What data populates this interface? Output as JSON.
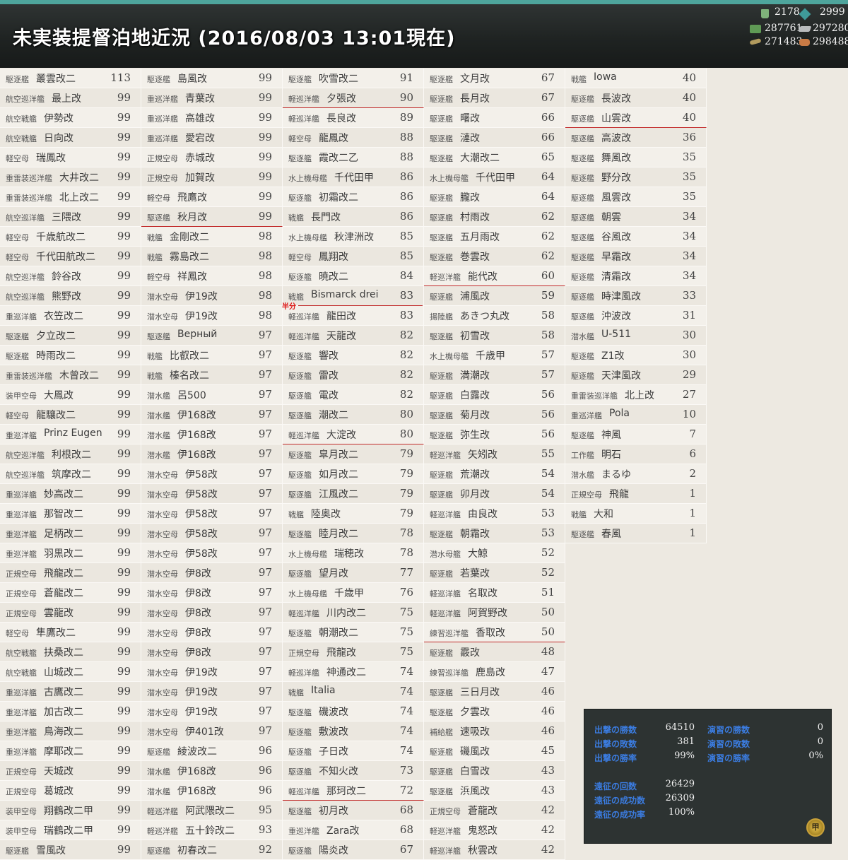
{
  "header": {
    "title": "未実装提督泊地近況 (2016/08/03 13:01現在)",
    "bucket": "2178",
    "devmat": "2999",
    "fuel": "287761",
    "steel": "297280",
    "ammo": "271483",
    "bauxite": "298488"
  },
  "hanbun_label": "半分",
  "ships": [
    {
      "type": "駆逐艦",
      "name": "叢雲改二",
      "lv": "113"
    },
    {
      "type": "航空巡洋艦",
      "name": "最上改",
      "lv": "99"
    },
    {
      "type": "航空戦艦",
      "name": "伊勢改",
      "lv": "99"
    },
    {
      "type": "航空戦艦",
      "name": "日向改",
      "lv": "99"
    },
    {
      "type": "軽空母",
      "name": "瑞鳳改",
      "lv": "99"
    },
    {
      "type": "重雷装巡洋艦",
      "name": "大井改二",
      "lv": "99"
    },
    {
      "type": "重雷装巡洋艦",
      "name": "北上改二",
      "lv": "99"
    },
    {
      "type": "航空巡洋艦",
      "name": "三隈改",
      "lv": "99"
    },
    {
      "type": "軽空母",
      "name": "千歳航改二",
      "lv": "99"
    },
    {
      "type": "軽空母",
      "name": "千代田航改二",
      "lv": "99"
    },
    {
      "type": "航空巡洋艦",
      "name": "鈴谷改",
      "lv": "99"
    },
    {
      "type": "航空巡洋艦",
      "name": "熊野改",
      "lv": "99"
    },
    {
      "type": "重巡洋艦",
      "name": "衣笠改二",
      "lv": "99"
    },
    {
      "type": "駆逐艦",
      "name": "夕立改二",
      "lv": "99"
    },
    {
      "type": "駆逐艦",
      "name": "時雨改二",
      "lv": "99"
    },
    {
      "type": "重雷装巡洋艦",
      "name": "木曾改二",
      "lv": "99"
    },
    {
      "type": "装甲空母",
      "name": "大鳳改",
      "lv": "99"
    },
    {
      "type": "軽空母",
      "name": "龍驤改二",
      "lv": "99"
    },
    {
      "type": "重巡洋艦",
      "name": "Prinz Eugen",
      "lv": "99"
    },
    {
      "type": "航空巡洋艦",
      "name": "利根改二",
      "lv": "99"
    },
    {
      "type": "航空巡洋艦",
      "name": "筑摩改二",
      "lv": "99"
    },
    {
      "type": "重巡洋艦",
      "name": "妙高改二",
      "lv": "99"
    },
    {
      "type": "重巡洋艦",
      "name": "那智改二",
      "lv": "99"
    },
    {
      "type": "重巡洋艦",
      "name": "足柄改二",
      "lv": "99"
    },
    {
      "type": "重巡洋艦",
      "name": "羽黒改二",
      "lv": "99"
    },
    {
      "type": "正規空母",
      "name": "飛龍改二",
      "lv": "99"
    },
    {
      "type": "正規空母",
      "name": "蒼龍改二",
      "lv": "99"
    },
    {
      "type": "正規空母",
      "name": "雲龍改",
      "lv": "99"
    },
    {
      "type": "軽空母",
      "name": "隼鷹改二",
      "lv": "99"
    },
    {
      "type": "航空戦艦",
      "name": "扶桑改二",
      "lv": "99"
    },
    {
      "type": "航空戦艦",
      "name": "山城改二",
      "lv": "99"
    },
    {
      "type": "重巡洋艦",
      "name": "古鷹改二",
      "lv": "99"
    },
    {
      "type": "重巡洋艦",
      "name": "加古改二",
      "lv": "99"
    },
    {
      "type": "重巡洋艦",
      "name": "鳥海改二",
      "lv": "99"
    },
    {
      "type": "重巡洋艦",
      "name": "摩耶改二",
      "lv": "99"
    },
    {
      "type": "正規空母",
      "name": "天城改",
      "lv": "99"
    },
    {
      "type": "正規空母",
      "name": "葛城改",
      "lv": "99"
    },
    {
      "type": "装甲空母",
      "name": "翔鶴改二甲",
      "lv": "99"
    },
    {
      "type": "装甲空母",
      "name": "瑞鶴改二甲",
      "lv": "99"
    },
    {
      "type": "駆逐艦",
      "name": "雪風改",
      "lv": "99"
    },
    {
      "type": "駆逐艦",
      "name": "島風改",
      "lv": "99"
    },
    {
      "type": "重巡洋艦",
      "name": "青葉改",
      "lv": "99"
    },
    {
      "type": "重巡洋艦",
      "name": "高雄改",
      "lv": "99"
    },
    {
      "type": "重巡洋艦",
      "name": "愛宕改",
      "lv": "99"
    },
    {
      "type": "正規空母",
      "name": "赤城改",
      "lv": "99"
    },
    {
      "type": "正規空母",
      "name": "加賀改",
      "lv": "99"
    },
    {
      "type": "軽空母",
      "name": "飛鷹改",
      "lv": "99"
    },
    {
      "type": "駆逐艦",
      "name": "秋月改",
      "lv": "99"
    },
    {
      "type": "戦艦",
      "name": "金剛改二",
      "lv": "98"
    },
    {
      "type": "戦艦",
      "name": "霧島改二",
      "lv": "98"
    },
    {
      "type": "軽空母",
      "name": "祥鳳改",
      "lv": "98"
    },
    {
      "type": "潜水空母",
      "name": "伊19改",
      "lv": "98"
    },
    {
      "type": "潜水空母",
      "name": "伊19改",
      "lv": "98"
    },
    {
      "type": "駆逐艦",
      "name": "Верный",
      "lv": "97"
    },
    {
      "type": "戦艦",
      "name": "比叡改二",
      "lv": "97"
    },
    {
      "type": "戦艦",
      "name": "榛名改二",
      "lv": "97"
    },
    {
      "type": "潜水艦",
      "name": "呂500",
      "lv": "97"
    },
    {
      "type": "潜水艦",
      "name": "伊168改",
      "lv": "97"
    },
    {
      "type": "潜水艦",
      "name": "伊168改",
      "lv": "97"
    },
    {
      "type": "潜水艦",
      "name": "伊168改",
      "lv": "97"
    },
    {
      "type": "潜水空母",
      "name": "伊58改",
      "lv": "97"
    },
    {
      "type": "潜水空母",
      "name": "伊58改",
      "lv": "97"
    },
    {
      "type": "潜水空母",
      "name": "伊58改",
      "lv": "97"
    },
    {
      "type": "潜水空母",
      "name": "伊58改",
      "lv": "97"
    },
    {
      "type": "潜水空母",
      "name": "伊58改",
      "lv": "97"
    },
    {
      "type": "潜水空母",
      "name": "伊8改",
      "lv": "97"
    },
    {
      "type": "潜水空母",
      "name": "伊8改",
      "lv": "97"
    },
    {
      "type": "潜水空母",
      "name": "伊8改",
      "lv": "97"
    },
    {
      "type": "潜水空母",
      "name": "伊8改",
      "lv": "97"
    },
    {
      "type": "潜水空母",
      "name": "伊8改",
      "lv": "97"
    },
    {
      "type": "潜水空母",
      "name": "伊19改",
      "lv": "97"
    },
    {
      "type": "潜水空母",
      "name": "伊19改",
      "lv": "97"
    },
    {
      "type": "潜水空母",
      "name": "伊19改",
      "lv": "97"
    },
    {
      "type": "潜水空母",
      "name": "伊401改",
      "lv": "97"
    },
    {
      "type": "駆逐艦",
      "name": "綾波改二",
      "lv": "96"
    },
    {
      "type": "潜水艦",
      "name": "伊168改",
      "lv": "96"
    },
    {
      "type": "潜水艦",
      "name": "伊168改",
      "lv": "96"
    },
    {
      "type": "軽巡洋艦",
      "name": "阿武隈改二",
      "lv": "95"
    },
    {
      "type": "軽巡洋艦",
      "name": "五十鈴改二",
      "lv": "93"
    },
    {
      "type": "駆逐艦",
      "name": "初春改二",
      "lv": "92"
    },
    {
      "type": "駆逐艦",
      "name": "吹雪改二",
      "lv": "91"
    },
    {
      "type": "軽巡洋艦",
      "name": "夕張改",
      "lv": "90"
    },
    {
      "type": "軽巡洋艦",
      "name": "長良改",
      "lv": "89"
    },
    {
      "type": "軽空母",
      "name": "龍鳳改",
      "lv": "88"
    },
    {
      "type": "駆逐艦",
      "name": "霞改二乙",
      "lv": "88"
    },
    {
      "type": "水上機母艦",
      "name": "千代田甲",
      "lv": "86"
    },
    {
      "type": "駆逐艦",
      "name": "初霜改二",
      "lv": "86"
    },
    {
      "type": "戦艦",
      "name": "長門改",
      "lv": "86"
    },
    {
      "type": "水上機母艦",
      "name": "秋津洲改",
      "lv": "85"
    },
    {
      "type": "軽空母",
      "name": "鳳翔改",
      "lv": "85"
    },
    {
      "type": "駆逐艦",
      "name": "暁改二",
      "lv": "84"
    },
    {
      "type": "戦艦",
      "name": "Bismarck drei",
      "lv": "83"
    },
    {
      "type": "軽巡洋艦",
      "name": "龍田改",
      "lv": "83"
    },
    {
      "type": "軽巡洋艦",
      "name": "天龍改",
      "lv": "82"
    },
    {
      "type": "駆逐艦",
      "name": "響改",
      "lv": "82"
    },
    {
      "type": "駆逐艦",
      "name": "雷改",
      "lv": "82"
    },
    {
      "type": "駆逐艦",
      "name": "電改",
      "lv": "82"
    },
    {
      "type": "駆逐艦",
      "name": "潮改二",
      "lv": "80"
    },
    {
      "type": "軽巡洋艦",
      "name": "大淀改",
      "lv": "80"
    },
    {
      "type": "駆逐艦",
      "name": "皐月改二",
      "lv": "79"
    },
    {
      "type": "駆逐艦",
      "name": "如月改二",
      "lv": "79"
    },
    {
      "type": "駆逐艦",
      "name": "江風改二",
      "lv": "79"
    },
    {
      "type": "戦艦",
      "name": "陸奥改",
      "lv": "79"
    },
    {
      "type": "駆逐艦",
      "name": "睦月改二",
      "lv": "78"
    },
    {
      "type": "水上機母艦",
      "name": "瑞穂改",
      "lv": "78"
    },
    {
      "type": "駆逐艦",
      "name": "望月改",
      "lv": "77"
    },
    {
      "type": "水上機母艦",
      "name": "千歳甲",
      "lv": "76"
    },
    {
      "type": "軽巡洋艦",
      "name": "川内改二",
      "lv": "75"
    },
    {
      "type": "駆逐艦",
      "name": "朝潮改二",
      "lv": "75"
    },
    {
      "type": "正規空母",
      "name": "飛龍改",
      "lv": "75"
    },
    {
      "type": "軽巡洋艦",
      "name": "神通改二",
      "lv": "74"
    },
    {
      "type": "戦艦",
      "name": "Italia",
      "lv": "74"
    },
    {
      "type": "駆逐艦",
      "name": "磯波改",
      "lv": "74"
    },
    {
      "type": "駆逐艦",
      "name": "敷波改",
      "lv": "74"
    },
    {
      "type": "駆逐艦",
      "name": "子日改",
      "lv": "74"
    },
    {
      "type": "駆逐艦",
      "name": "不知火改",
      "lv": "73"
    },
    {
      "type": "軽巡洋艦",
      "name": "那珂改二",
      "lv": "72"
    },
    {
      "type": "駆逐艦",
      "name": "初月改",
      "lv": "68"
    },
    {
      "type": "重巡洋艦",
      "name": "Zara改",
      "lv": "68"
    },
    {
      "type": "駆逐艦",
      "name": "陽炎改",
      "lv": "67"
    },
    {
      "type": "駆逐艦",
      "name": "文月改",
      "lv": "67"
    },
    {
      "type": "駆逐艦",
      "name": "長月改",
      "lv": "67"
    },
    {
      "type": "駆逐艦",
      "name": "曙改",
      "lv": "66"
    },
    {
      "type": "駆逐艦",
      "name": "漣改",
      "lv": "66"
    },
    {
      "type": "駆逐艦",
      "name": "大潮改二",
      "lv": "65"
    },
    {
      "type": "水上機母艦",
      "name": "千代田甲",
      "lv": "64"
    },
    {
      "type": "駆逐艦",
      "name": "朧改",
      "lv": "64"
    },
    {
      "type": "駆逐艦",
      "name": "村雨改",
      "lv": "62"
    },
    {
      "type": "駆逐艦",
      "name": "五月雨改",
      "lv": "62"
    },
    {
      "type": "駆逐艦",
      "name": "巻雲改",
      "lv": "62"
    },
    {
      "type": "軽巡洋艦",
      "name": "能代改",
      "lv": "60"
    },
    {
      "type": "駆逐艦",
      "name": "浦風改",
      "lv": "59"
    },
    {
      "type": "揚陸艦",
      "name": "あきつ丸改",
      "lv": "58"
    },
    {
      "type": "駆逐艦",
      "name": "初雪改",
      "lv": "58"
    },
    {
      "type": "水上機母艦",
      "name": "千歳甲",
      "lv": "57"
    },
    {
      "type": "駆逐艦",
      "name": "満潮改",
      "lv": "57"
    },
    {
      "type": "駆逐艦",
      "name": "白露改",
      "lv": "56"
    },
    {
      "type": "駆逐艦",
      "name": "菊月改",
      "lv": "56"
    },
    {
      "type": "駆逐艦",
      "name": "弥生改",
      "lv": "56"
    },
    {
      "type": "軽巡洋艦",
      "name": "矢矧改",
      "lv": "55"
    },
    {
      "type": "駆逐艦",
      "name": "荒潮改",
      "lv": "54"
    },
    {
      "type": "駆逐艦",
      "name": "卯月改",
      "lv": "54"
    },
    {
      "type": "軽巡洋艦",
      "name": "由良改",
      "lv": "53"
    },
    {
      "type": "駆逐艦",
      "name": "朝霜改",
      "lv": "53"
    },
    {
      "type": "潜水母艦",
      "name": "大鯨",
      "lv": "52"
    },
    {
      "type": "駆逐艦",
      "name": "若葉改",
      "lv": "52"
    },
    {
      "type": "軽巡洋艦",
      "name": "名取改",
      "lv": "51"
    },
    {
      "type": "軽巡洋艦",
      "name": "阿賀野改",
      "lv": "50"
    },
    {
      "type": "練習巡洋艦",
      "name": "香取改",
      "lv": "50"
    },
    {
      "type": "駆逐艦",
      "name": "霰改",
      "lv": "48"
    },
    {
      "type": "練習巡洋艦",
      "name": "鹿島改",
      "lv": "47"
    },
    {
      "type": "駆逐艦",
      "name": "三日月改",
      "lv": "46"
    },
    {
      "type": "駆逐艦",
      "name": "夕雲改",
      "lv": "46"
    },
    {
      "type": "補給艦",
      "name": "速吸改",
      "lv": "46"
    },
    {
      "type": "駆逐艦",
      "name": "磯風改",
      "lv": "45"
    },
    {
      "type": "駆逐艦",
      "name": "白雪改",
      "lv": "43"
    },
    {
      "type": "駆逐艦",
      "name": "浜風改",
      "lv": "43"
    },
    {
      "type": "正規空母",
      "name": "蒼龍改",
      "lv": "42"
    },
    {
      "type": "軽巡洋艦",
      "name": "鬼怒改",
      "lv": "42"
    },
    {
      "type": "軽巡洋艦",
      "name": "秋雲改",
      "lv": "42"
    },
    {
      "type": "戦艦",
      "name": "Iowa",
      "lv": "40"
    },
    {
      "type": "駆逐艦",
      "name": "長波改",
      "lv": "40"
    },
    {
      "type": "駆逐艦",
      "name": "山雲改",
      "lv": "40"
    },
    {
      "type": "駆逐艦",
      "name": "高波改",
      "lv": "36"
    },
    {
      "type": "駆逐艦",
      "name": "舞風改",
      "lv": "35"
    },
    {
      "type": "駆逐艦",
      "name": "野分改",
      "lv": "35"
    },
    {
      "type": "駆逐艦",
      "name": "風雲改",
      "lv": "35"
    },
    {
      "type": "駆逐艦",
      "name": "朝雲",
      "lv": "34"
    },
    {
      "type": "駆逐艦",
      "name": "谷風改",
      "lv": "34"
    },
    {
      "type": "駆逐艦",
      "name": "早霜改",
      "lv": "34"
    },
    {
      "type": "駆逐艦",
      "name": "清霜改",
      "lv": "34"
    },
    {
      "type": "駆逐艦",
      "name": "時津風改",
      "lv": "33"
    },
    {
      "type": "駆逐艦",
      "name": "沖波改",
      "lv": "31"
    },
    {
      "type": "潜水艦",
      "name": "U-511",
      "lv": "30"
    },
    {
      "type": "駆逐艦",
      "name": "Z1改",
      "lv": "30"
    },
    {
      "type": "駆逐艦",
      "name": "天津風改",
      "lv": "29"
    },
    {
      "type": "重雷装巡洋艦",
      "name": "北上改",
      "lv": "27"
    },
    {
      "type": "重巡洋艦",
      "name": "Pola",
      "lv": "10"
    },
    {
      "type": "駆逐艦",
      "name": "神風",
      "lv": "7"
    },
    {
      "type": "工作艦",
      "name": "明石",
      "lv": "6"
    },
    {
      "type": "潜水艦",
      "name": "まるゆ",
      "lv": "2"
    },
    {
      "type": "正規空母",
      "name": "飛龍",
      "lv": "1"
    },
    {
      "type": "戦艦",
      "name": "大和",
      "lv": "1"
    },
    {
      "type": "駆逐艦",
      "name": "春風",
      "lv": "1"
    }
  ],
  "stats": {
    "sortie_wins_label": "出撃の勝数",
    "sortie_wins": "64510",
    "sortie_losses_label": "出撃の敗数",
    "sortie_losses": "381",
    "sortie_rate_label": "出撃の勝率",
    "sortie_rate": "99%",
    "exercise_wins_label": "演習の勝数",
    "exercise_wins": "0",
    "exercise_losses_label": "演習の敗数",
    "exercise_losses": "0",
    "exercise_rate_label": "演習の勝率",
    "exercise_rate": "0%",
    "expedition_count_label": "遠征の回数",
    "expedition_count": "26429",
    "expedition_success_label": "遠征の成功数",
    "expedition_success": "26309",
    "expedition_rate_label": "遠征の成功率",
    "expedition_rate": "100%",
    "emblem": "甲"
  }
}
